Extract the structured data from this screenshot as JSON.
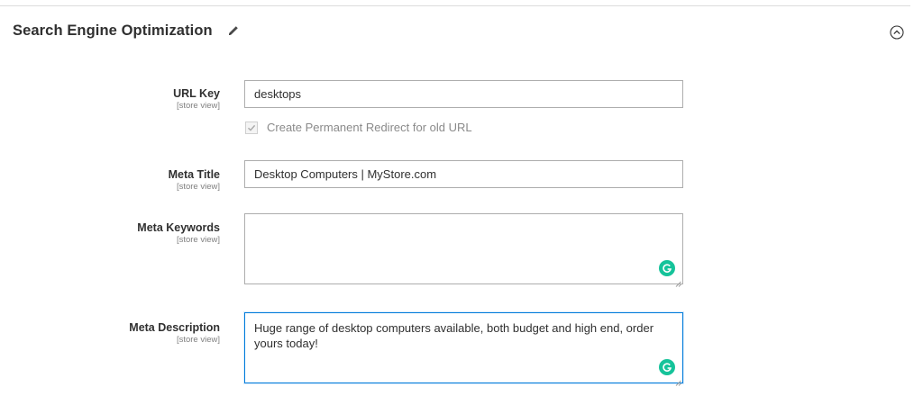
{
  "section": {
    "title": "Search Engine Optimization",
    "edit_icon": "pencil-icon",
    "collapse_icon": "circle-chevron-up-icon"
  },
  "fields": {
    "url_key": {
      "label": "URL Key",
      "scope": "[store view]",
      "value": "desktops"
    },
    "redirect": {
      "label": "Create Permanent Redirect for old URL",
      "checked": true
    },
    "meta_title": {
      "label": "Meta Title",
      "scope": "[store view]",
      "value": "Desktop Computers | MyStore.com"
    },
    "meta_keywords": {
      "label": "Meta Keywords",
      "scope": "[store view]",
      "value": ""
    },
    "meta_description": {
      "label": "Meta Description",
      "scope": "[store view]",
      "value": "Huge range of desktop computers available, both budget and high end, order yours today!"
    }
  },
  "colors": {
    "grammarly": "#15c39a",
    "focus_border": "#007bdb",
    "border": "#adadad"
  }
}
